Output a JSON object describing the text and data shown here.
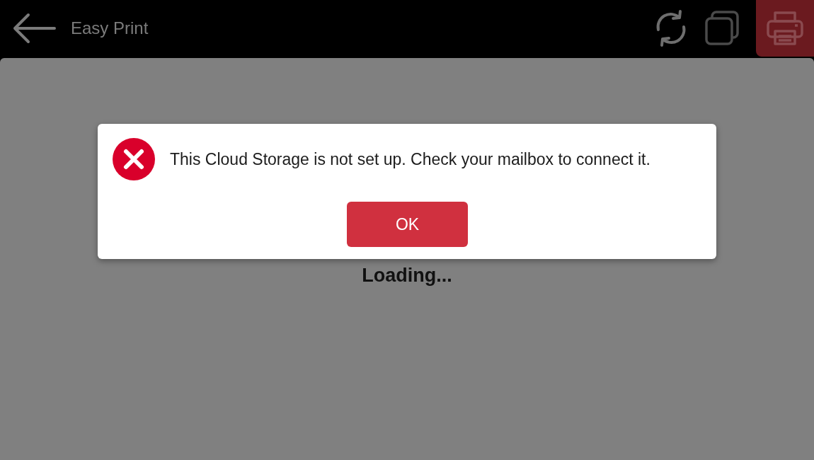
{
  "app_bar": {
    "title": "Easy Print"
  },
  "content": {
    "status": "Loading..."
  },
  "dialog": {
    "kind": "error",
    "message": "This Cloud Storage is not set up. Check your mailbox to connect it.",
    "buttons": [
      "OK"
    ]
  }
}
